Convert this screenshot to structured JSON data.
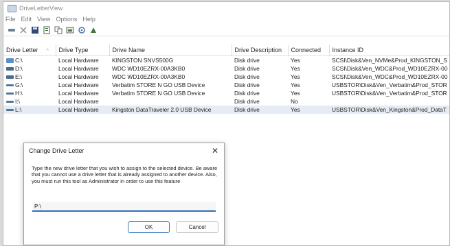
{
  "window": {
    "title": "DriveLetterView"
  },
  "menu": [
    "File",
    "Edit",
    "View",
    "Options",
    "Help"
  ],
  "toolbar": [
    {
      "icon": "drive-icon"
    },
    {
      "icon": "delete-icon"
    },
    {
      "icon": "save-icon"
    },
    {
      "icon": "properties-icon"
    },
    {
      "icon": "copy-icon"
    },
    {
      "icon": "html-report-icon"
    },
    {
      "icon": "refresh-icon"
    },
    {
      "icon": "exit-icon"
    }
  ],
  "table": {
    "columns": [
      "Drive Letter",
      "Drive Type",
      "Drive Name",
      "Drive Description",
      "Connected",
      "Instance ID"
    ],
    "rows": [
      {
        "letter": "C:\\",
        "type": "Local Hardware",
        "name": "KINGSTON SNVS500G",
        "desc": "Disk drive",
        "connected": "Yes",
        "id": "SCSI\\Disk&Ven_NVMe&Prod_KINGSTON_S",
        "icon": "system-drive-icon",
        "selected": false
      },
      {
        "letter": "D:\\",
        "type": "Local Hardware",
        "name": "WDC WD10EZRX-00A3KB0",
        "desc": "Disk drive",
        "connected": "Yes",
        "id": "SCSI\\Disk&Ven_WDC&Prod_WD10EZRX-00",
        "icon": "hard-drive-icon",
        "selected": false
      },
      {
        "letter": "E:\\",
        "type": "Local Hardware",
        "name": "WDC WD10EZRX-00A3KB0",
        "desc": "Disk drive",
        "connected": "Yes",
        "id": "SCSI\\Disk&Ven_WDC&Prod_WD10EZRX-00",
        "icon": "hard-drive-icon",
        "selected": false
      },
      {
        "letter": "G:\\",
        "type": "Local Hardware",
        "name": "Verbatim STORE N GO USB Device",
        "desc": "Disk drive",
        "connected": "Yes",
        "id": "USBSTOR\\Disk&Ven_Verbatim&Prod_STOR",
        "icon": "usb-drive-icon",
        "selected": false
      },
      {
        "letter": "H:\\",
        "type": "Local Hardware",
        "name": "Verbatim STORE N GO USB Device",
        "desc": "Disk drive",
        "connected": "Yes",
        "id": "USBSTOR\\Disk&Ven_Verbatim&Prod_STOR",
        "icon": "usb-drive-icon",
        "selected": false
      },
      {
        "letter": "I:\\",
        "type": "Local Hardware",
        "name": "",
        "desc": "Disk drive",
        "connected": "No",
        "id": "",
        "icon": "usb-drive-icon",
        "selected": false
      },
      {
        "letter": "L:\\",
        "type": "Local Hardware",
        "name": "Kingston DataTraveler 2.0 USB Device",
        "desc": "Disk drive",
        "connected": "Yes",
        "id": "USBSTOR\\Disk&Ven_Kingston&Prod_DataT",
        "icon": "usb-drive-icon",
        "selected": true
      }
    ]
  },
  "dialog": {
    "title": "Change Drive Letter",
    "message": "Type the new drive letter that you wish to assign to the selected device. Be aware that you cannot use a drive letter that is already assigned to another device. Also, you must run this tool as Administrator in order to use this feature",
    "input_value": "P:\\",
    "ok_label": "OK",
    "cancel_label": "Cancel"
  },
  "colors": {
    "accent": "#2f6fb6",
    "selection": "#e6ecf3"
  }
}
